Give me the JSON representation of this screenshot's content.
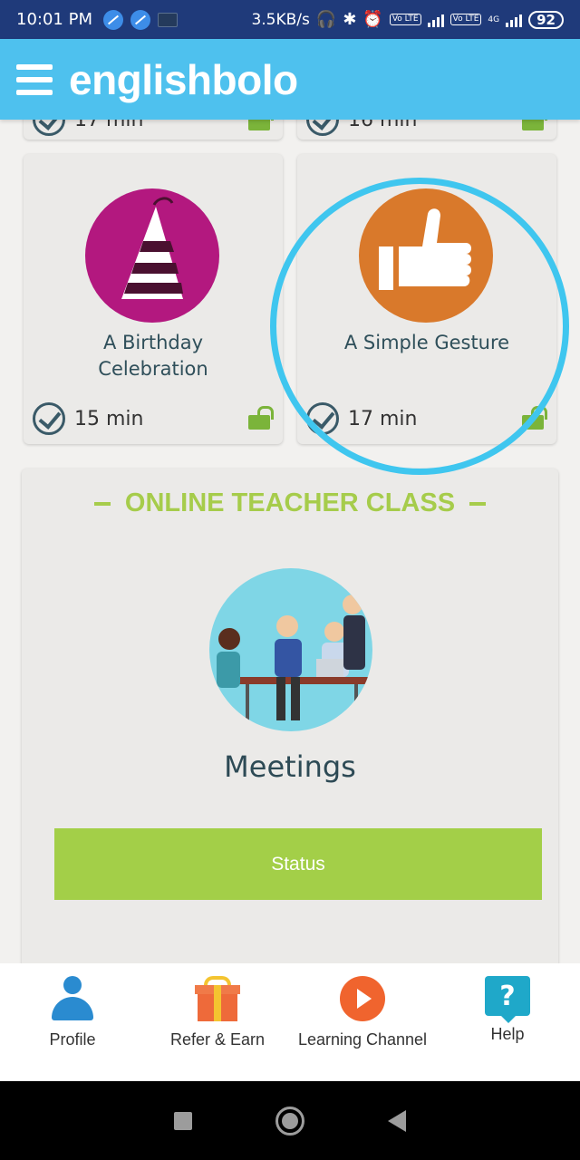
{
  "status_bar": {
    "time": "10:01 PM",
    "network_speed": "3.5KB/s",
    "lte1": "Vo LTE",
    "lte2": "Vo LTE",
    "net_type": "4G",
    "battery": "92"
  },
  "app_bar": {
    "brand": "englishbolo",
    "menu_icon": "hamburger-icon",
    "color": "#4ec1ee"
  },
  "partial_cards": [
    {
      "duration": "17 min"
    },
    {
      "duration": "16 min"
    }
  ],
  "lessons": [
    {
      "title_line1": "A Birthday",
      "title_line2": "Celebration",
      "duration": "15 min",
      "icon": "party-hat-icon",
      "circle_color": "#b3187f"
    },
    {
      "title_line1": "A Simple Gesture",
      "title_line2": "",
      "duration": "17 min",
      "icon": "thumbs-up-icon",
      "circle_color": "#d9792b"
    }
  ],
  "teacher_class": {
    "section_title": "ONLINE TEACHER CLASS",
    "class_title": "Meetings",
    "status_button": "Status",
    "accent_color": "#a3cf48"
  },
  "bottom_nav": {
    "items": [
      {
        "label": "Profile",
        "icon": "profile-icon"
      },
      {
        "label": "Refer & Earn",
        "icon": "gift-icon"
      },
      {
        "label": "Learning Channel",
        "icon": "play-icon"
      },
      {
        "label": "Help",
        "icon": "help-icon"
      }
    ]
  }
}
